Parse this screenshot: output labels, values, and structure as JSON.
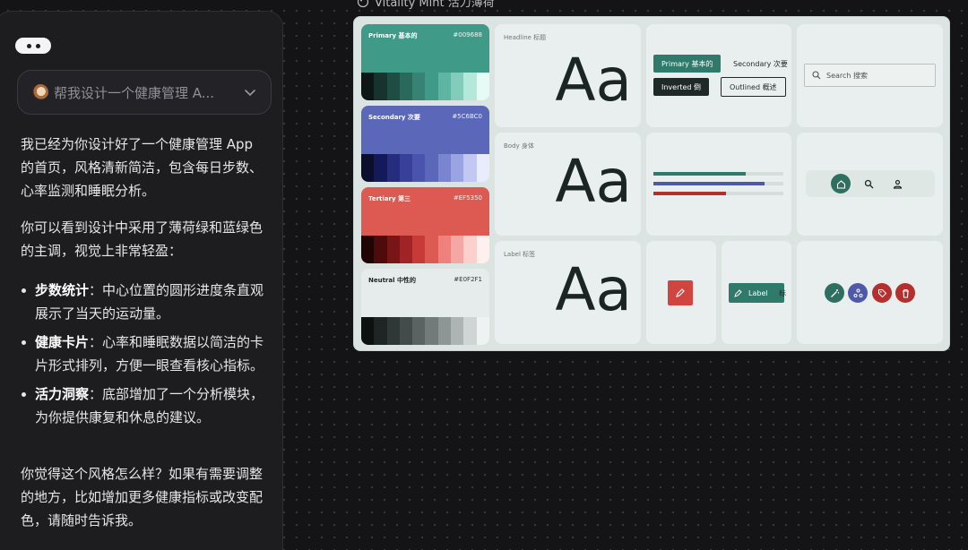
{
  "chat": {
    "prompt": "帮我设计一个健康管理 A...",
    "p1": "我已经为你设计好了一个健康管理 App 的首页，风格清新简洁，包含每日步数、心率监测和睡眠分析。",
    "p2": "你可以看到设计中采用了薄荷绿和蓝绿色的主调，视觉上非常轻盈：",
    "bullets": [
      {
        "title": "步数统计",
        "text": "：中心位置的圆形进度条直观展示了当天的运动量。"
      },
      {
        "title": "健康卡片",
        "text": "：心率和睡眠数据以简洁的卡片形式排列，方便一眼查看核心指标。"
      },
      {
        "title": "活力洞察",
        "text": "：底部增加了一个分析模块，为你提供康复和休息的建议。"
      }
    ],
    "p3": "你觉得这个风格怎么样？如果有需要调整的地方，比如增加更多健康指标或改变配色，请随时告诉我。"
  },
  "board": {
    "title": "Vitality Mint  活力薄荷",
    "palettes": [
      {
        "name": "Primary  基本的",
        "hex": "#009688",
        "color": "#3f9b88",
        "text": "#ffffff",
        "swatches": [
          "#0d1715",
          "#16332d",
          "#1e4d44",
          "#2a6a5c",
          "#368273",
          "#3f9b88",
          "#5db5a2",
          "#83ccbb",
          "#b3e8da",
          "#e6fbf5"
        ]
      },
      {
        "name": "Secondary  次要",
        "hex": "#5C6BC0",
        "color": "#5b67b8",
        "text": "#ffffff",
        "swatches": [
          "#0b0e2c",
          "#14195a",
          "#252d7c",
          "#38409a",
          "#4a54ad",
          "#5b67b8",
          "#7a84cf",
          "#9ba4e3",
          "#c2c8f2",
          "#e9ecfd"
        ]
      },
      {
        "name": "Tertiary  第三",
        "hex": "#EF5350",
        "color": "#dd5a53",
        "text": "#ffffff",
        "swatches": [
          "#210505",
          "#4d0b0c",
          "#781516",
          "#a02425",
          "#c73a37",
          "#dd5a53",
          "#ee817b",
          "#f5a8a3",
          "#fbd0cd",
          "#fff0ee"
        ]
      },
      {
        "name": "Neutral  中性的",
        "hex": "#E0F2F1",
        "color": "#e6eceb",
        "text": "#1a2422",
        "swatches": [
          "#0d1110",
          "#1e2524",
          "#303837",
          "#444c4b",
          "#5b6362",
          "#737b7a",
          "#8e9695",
          "#adb4b3",
          "#cfd5d4",
          "#eef2f1"
        ]
      }
    ],
    "typography": [
      {
        "label": "Headline  标题",
        "sample": "Aa"
      },
      {
        "label": "Body  身体",
        "sample": "Aa"
      },
      {
        "label": "Label  标签",
        "sample": "Aa"
      }
    ],
    "buttons": {
      "primary": "Primary  基本的",
      "secondary": "Secondary  次要",
      "inverted": "Inverted  倒",
      "outlined": "Outlined  概述",
      "label": "Label",
      "label_extra": "标"
    },
    "search": {
      "placeholder": "Search  搜索"
    },
    "colors": {
      "primary": "#2f7a6b",
      "secondary": "#4e5aa8",
      "tertiary": "#b3302f",
      "dark": "#1f2a28"
    }
  }
}
